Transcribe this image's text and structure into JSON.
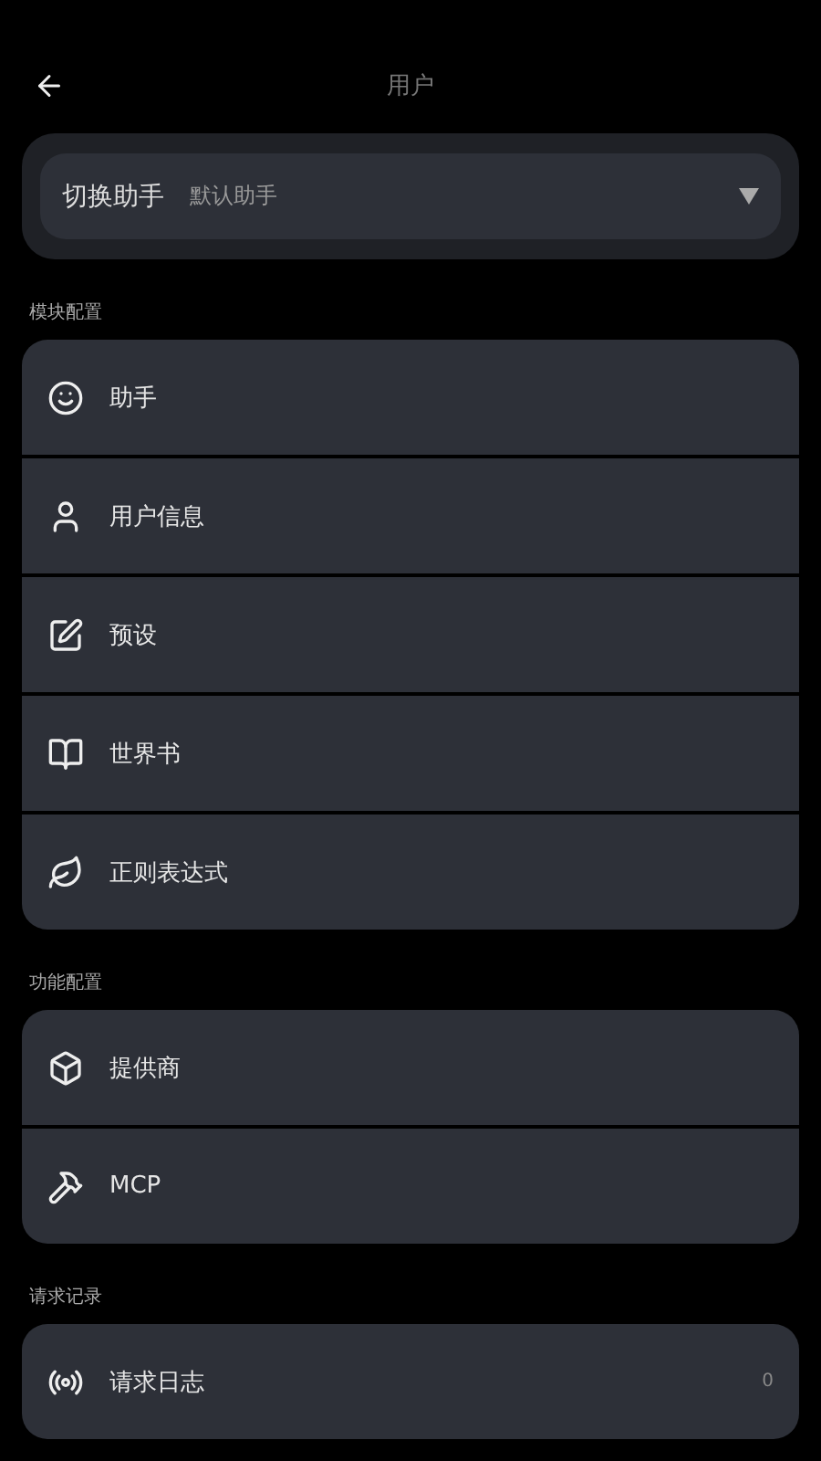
{
  "header": {
    "title": "用户"
  },
  "switcher": {
    "label": "切换助手",
    "value": "默认助手"
  },
  "sections": [
    {
      "title": "模块配置",
      "items": [
        {
          "label": "助手"
        },
        {
          "label": "用户信息"
        },
        {
          "label": "预设"
        },
        {
          "label": "世界书"
        },
        {
          "label": "正则表达式"
        }
      ]
    },
    {
      "title": "功能配置",
      "items": [
        {
          "label": "提供商"
        },
        {
          "label": "MCP"
        }
      ]
    },
    {
      "title": "请求记录",
      "items": [
        {
          "label": "请求日志",
          "count": "0"
        }
      ]
    }
  ]
}
